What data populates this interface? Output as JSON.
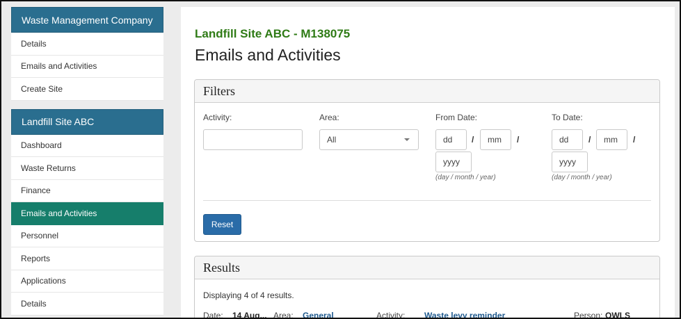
{
  "company": {
    "heading": "Waste Management Company",
    "items": [
      "Details",
      "Emails and Activities",
      "Create Site"
    ]
  },
  "site": {
    "heading": "Landfill Site ABC",
    "items": [
      "Dashboard",
      "Waste Returns",
      "Finance",
      "Emails and Activities",
      "Personnel",
      "Reports",
      "Applications",
      "Details"
    ],
    "active_index": 3
  },
  "main": {
    "site_title": "Landfill Site ABC - M138075",
    "page_title": "Emails and Activities"
  },
  "filters": {
    "title": "Filters",
    "activity_label": "Activity:",
    "activity_value": "",
    "area_label": "Area:",
    "area_value": "All",
    "from_label": "From Date:",
    "to_label": "To Date:",
    "day_placeholder": "dd",
    "month_placeholder": "mm",
    "year_placeholder": "yyyy",
    "slash": "/",
    "date_hint": "(day / month / year)",
    "reset_label": "Reset"
  },
  "results": {
    "title": "Results",
    "summary": "Displaying 4 of 4 results.",
    "rows": [
      {
        "date_label": "Date:",
        "date_value": "14 Aug...",
        "area_label": "Area:",
        "area_value": "General",
        "activity_label": "Activity:",
        "activity_value": "Waste levy reminder",
        "person_label": "Person:",
        "person_value": "OWLS"
      }
    ]
  },
  "colors": {
    "panel_header": "#2a6e8f",
    "active_item": "#167e6b",
    "site_title": "#2f7b16",
    "reset_button": "#2a6ca8",
    "link": "#1f5a8e"
  }
}
